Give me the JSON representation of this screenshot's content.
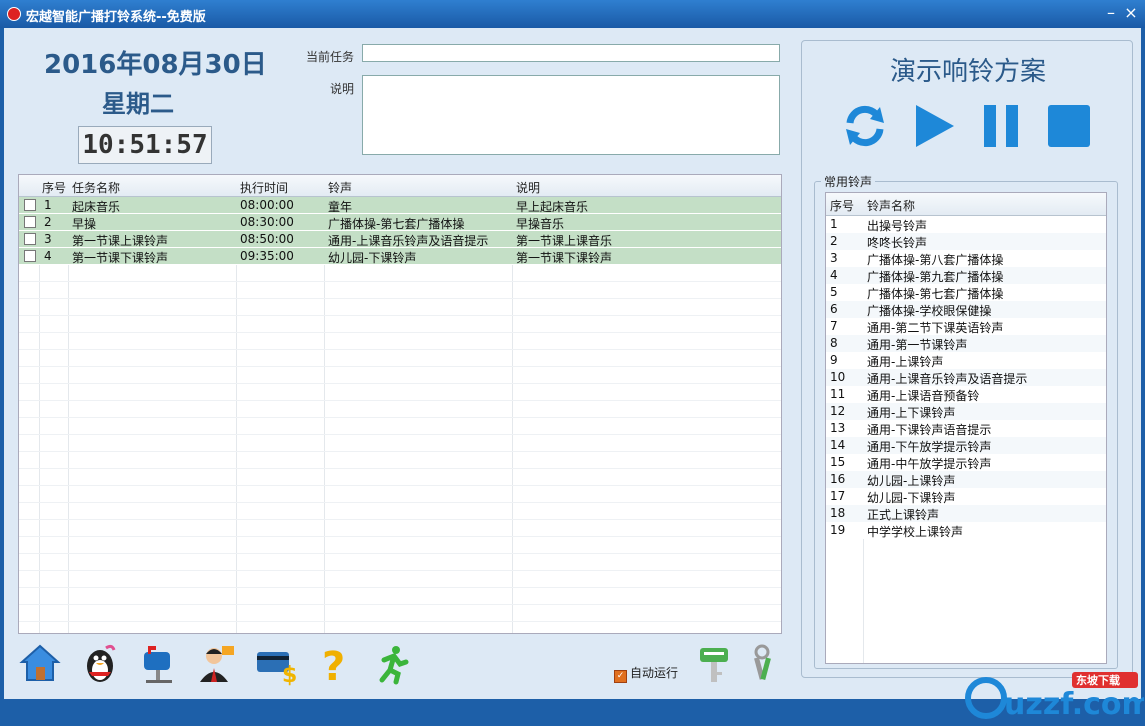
{
  "window": {
    "title": "宏越智能广播打铃系统--免费版",
    "minimize_label": "–",
    "close_label": "×"
  },
  "clock": {
    "date": "2016年08月30日",
    "weekday": "星期二",
    "time": "10:51:57"
  },
  "task_form": {
    "current_task_label": "当前任务",
    "current_task_value": "",
    "description_label": "说明",
    "description_value": ""
  },
  "task_table": {
    "columns": [
      "序号",
      "任务名称",
      "执行时间",
      "铃声",
      "说明"
    ],
    "rows": [
      {
        "no": "1",
        "name": "起床音乐",
        "time": "08:00:00",
        "ring": "童年",
        "desc": "早上起床音乐"
      },
      {
        "no": "2",
        "name": "早操",
        "time": "08:30:00",
        "ring": "广播体操-第七套广播体操",
        "desc": "早操音乐"
      },
      {
        "no": "3",
        "name": "第一节课上课铃声",
        "time": "08:50:00",
        "ring": "通用-上课音乐铃声及语音提示",
        "desc": "第一节课上课音乐"
      },
      {
        "no": "4",
        "name": "第一节课下课铃声",
        "time": "09:35:00",
        "ring": "幼儿园-下课铃声",
        "desc": "第一节课下课铃声"
      }
    ]
  },
  "toolbar": {
    "items": [
      "home-icon",
      "qq-penguin-icon",
      "mailbox-icon",
      "support-agent-icon",
      "payment-card-icon",
      "help-question-icon",
      "exit-running-man-icon",
      "key-icon",
      "keys-icon"
    ]
  },
  "auto_run": {
    "label": "自动运行",
    "checked": true,
    "check_mark": "✓"
  },
  "demo_panel": {
    "title": "演示响铃方案",
    "controls": [
      "refresh-icon",
      "play-icon",
      "pause-icon",
      "stop-icon"
    ]
  },
  "common_rings": {
    "group_label": "常用铃声",
    "columns": [
      "序号",
      "铃声名称"
    ],
    "rows": [
      {
        "no": "1",
        "name": "出操号铃声"
      },
      {
        "no": "2",
        "name": "咚咚长铃声"
      },
      {
        "no": "3",
        "name": "广播体操-第八套广播体操"
      },
      {
        "no": "4",
        "name": "广播体操-第九套广播体操"
      },
      {
        "no": "5",
        "name": "广播体操-第七套广播体操"
      },
      {
        "no": "6",
        "name": "广播体操-学校眼保健操"
      },
      {
        "no": "7",
        "name": "通用-第二节下课英语铃声"
      },
      {
        "no": "8",
        "name": "通用-第一节课铃声"
      },
      {
        "no": "9",
        "name": "通用-上课铃声"
      },
      {
        "no": "10",
        "name": "通用-上课音乐铃声及语音提示"
      },
      {
        "no": "11",
        "name": "通用-上课语音预备铃"
      },
      {
        "no": "12",
        "name": "通用-上下课铃声"
      },
      {
        "no": "13",
        "name": "通用-下课铃声语音提示"
      },
      {
        "no": "14",
        "name": "通用-下午放学提示铃声"
      },
      {
        "no": "15",
        "name": "通用-中午放学提示铃声"
      },
      {
        "no": "16",
        "name": "幼儿园-上课铃声"
      },
      {
        "no": "17",
        "name": "幼儿园-下课铃声"
      },
      {
        "no": "18",
        "name": "正式上课铃声"
      },
      {
        "no": "19",
        "name": "中学学校上课铃声"
      }
    ]
  },
  "watermark": {
    "text": "uzzf.com",
    "badge": "东坡下载"
  },
  "colors": {
    "title_bar": "#1a5aa6",
    "client_bg": "#dde9f5",
    "heading": "#2b5a8a",
    "row_fill": "#c4dfc6",
    "control_blue": "#1e88d8"
  }
}
